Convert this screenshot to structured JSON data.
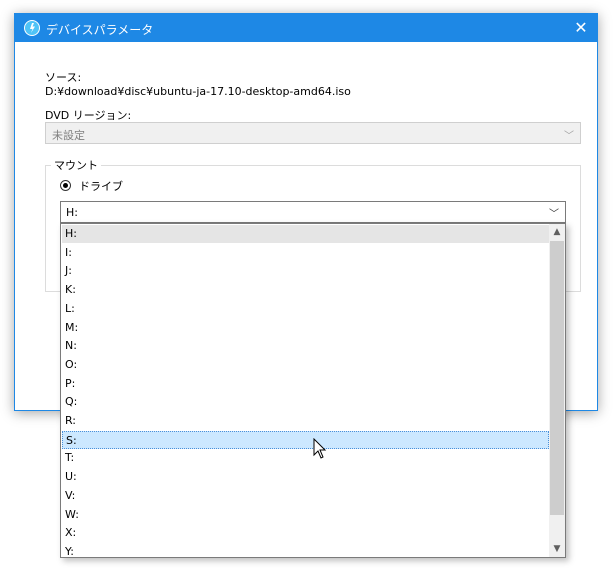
{
  "window": {
    "title": "デバイスパラメータ",
    "close": "✕"
  },
  "source": {
    "label": "ソース:",
    "path": "D:¥download¥disc¥ubuntu-ja-17.10-desktop-amd64.iso"
  },
  "dvd_region": {
    "label": "DVD リージョン:",
    "value": "未設定"
  },
  "mount": {
    "group_label": "マウント",
    "drive_radio_label": "ドライブ",
    "drive_radio_selected": true,
    "drive_value": "H:",
    "dropdown": {
      "current": "H:",
      "hovered": "S:",
      "items": [
        "H:",
        "I:",
        "J:",
        "K:",
        "L:",
        "M:",
        "N:",
        "O:",
        "P:",
        "Q:",
        "R:",
        "S:",
        "T:",
        "U:",
        "V:",
        "W:",
        "X:",
        "Y:"
      ]
    }
  },
  "icons": {
    "chevron": "chevron-down-icon",
    "scroll_up": "scroll-up-icon",
    "scroll_down": "scroll-down-icon",
    "app": "daemon-tools-icon"
  },
  "colors": {
    "accent": "#1e88e5",
    "hover": "#cce8ff"
  }
}
